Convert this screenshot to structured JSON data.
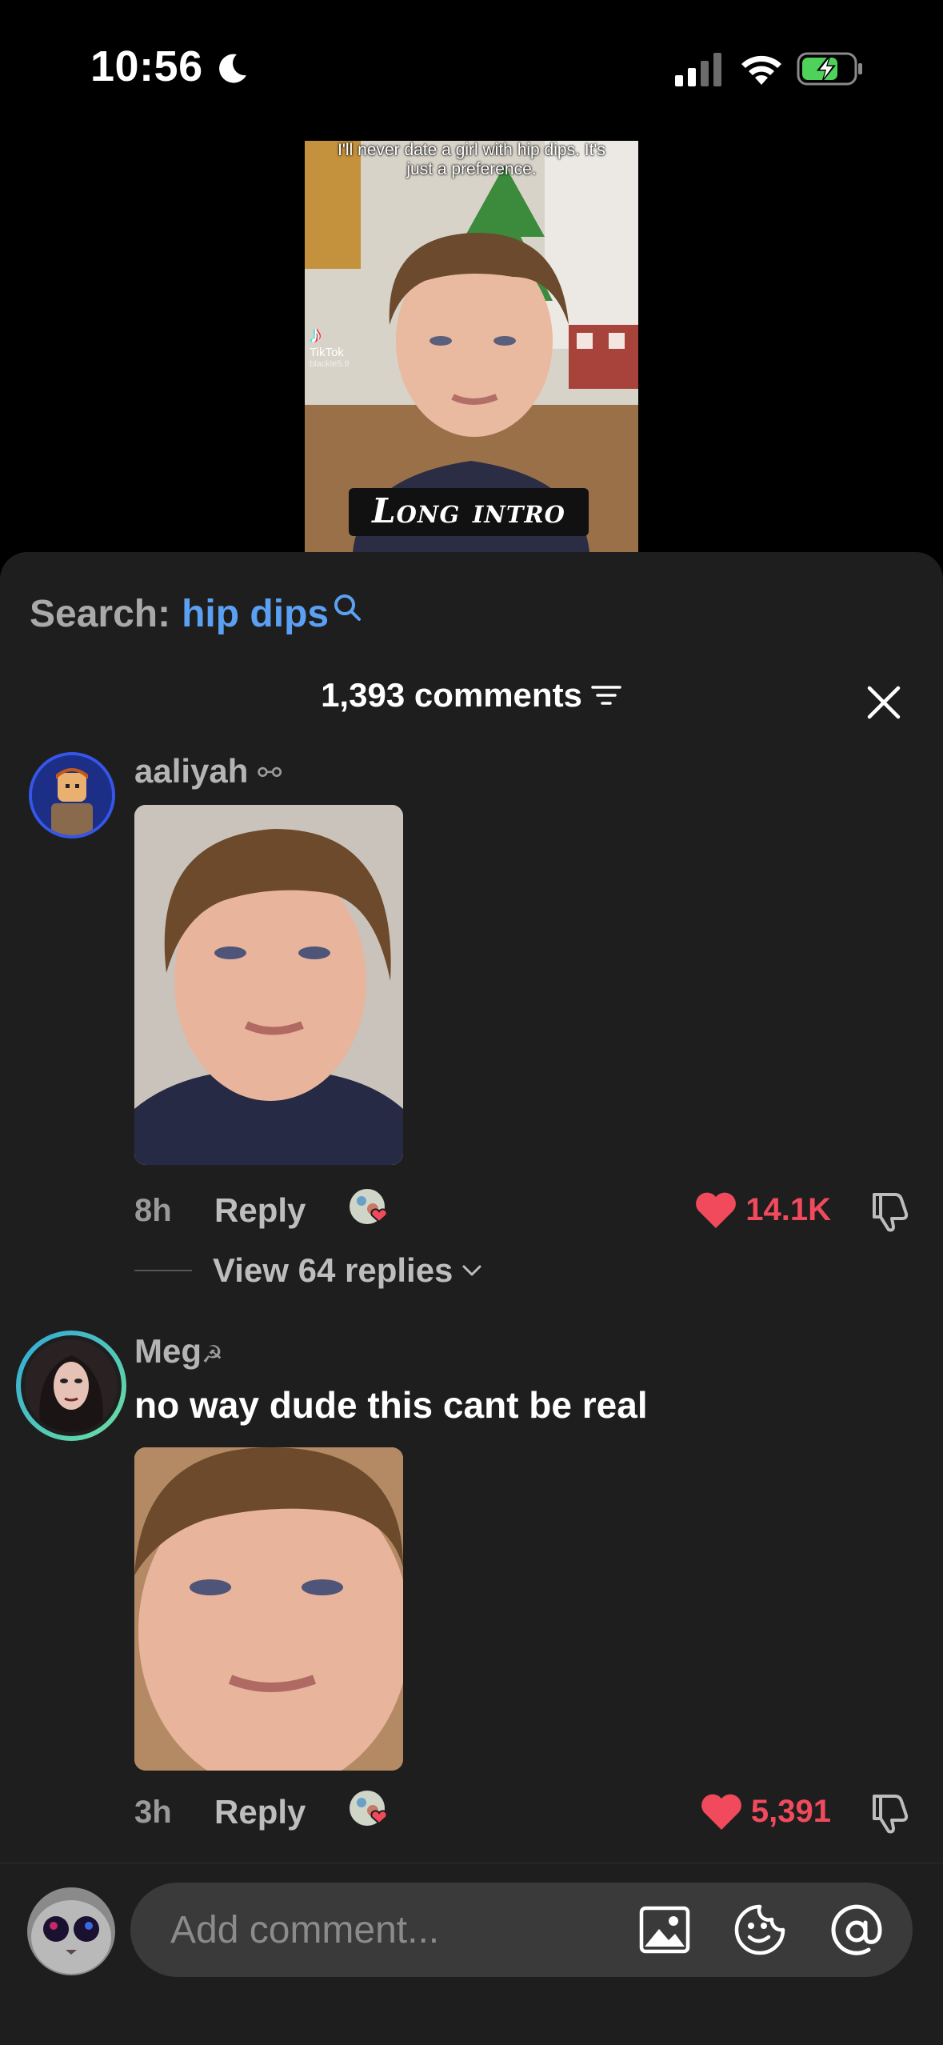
{
  "status_bar": {
    "time": "10:56"
  },
  "video": {
    "overlay_text": "I'll never date a girl with hip dips. It's just a preference.",
    "watermark_brand": "TikTok",
    "watermark_user": "blackie5.9",
    "caption": "Long intro"
  },
  "search": {
    "label": "Search:",
    "term": "hip dips"
  },
  "comments_header": {
    "count_text": "1,393 comments"
  },
  "comments": [
    {
      "username": "aaliyah",
      "username_suffix": "⚯",
      "text": "",
      "time": "8h",
      "reply_label": "Reply",
      "likes": "14.1K",
      "view_replies": "View 64 replies"
    },
    {
      "username": "Meg",
      "username_suffix": "☭",
      "text": "no way dude this cant be real",
      "time": "3h",
      "reply_label": "Reply",
      "likes": "5,391"
    }
  ],
  "composer": {
    "placeholder": "Add comment..."
  },
  "colors": {
    "sheet_bg": "#1e1e1e",
    "search_term": "#5ba0f2",
    "like_red": "#f04a5c",
    "input_bg": "#3a3a3a"
  },
  "icons": [
    "moon-icon",
    "signal-icon",
    "wifi-icon",
    "battery-charging-icon",
    "search-icon",
    "filter-icon",
    "close-icon",
    "heart-icon",
    "dislike-icon",
    "chevron-down-icon",
    "image-icon",
    "emoji-icon",
    "mention-icon"
  ]
}
